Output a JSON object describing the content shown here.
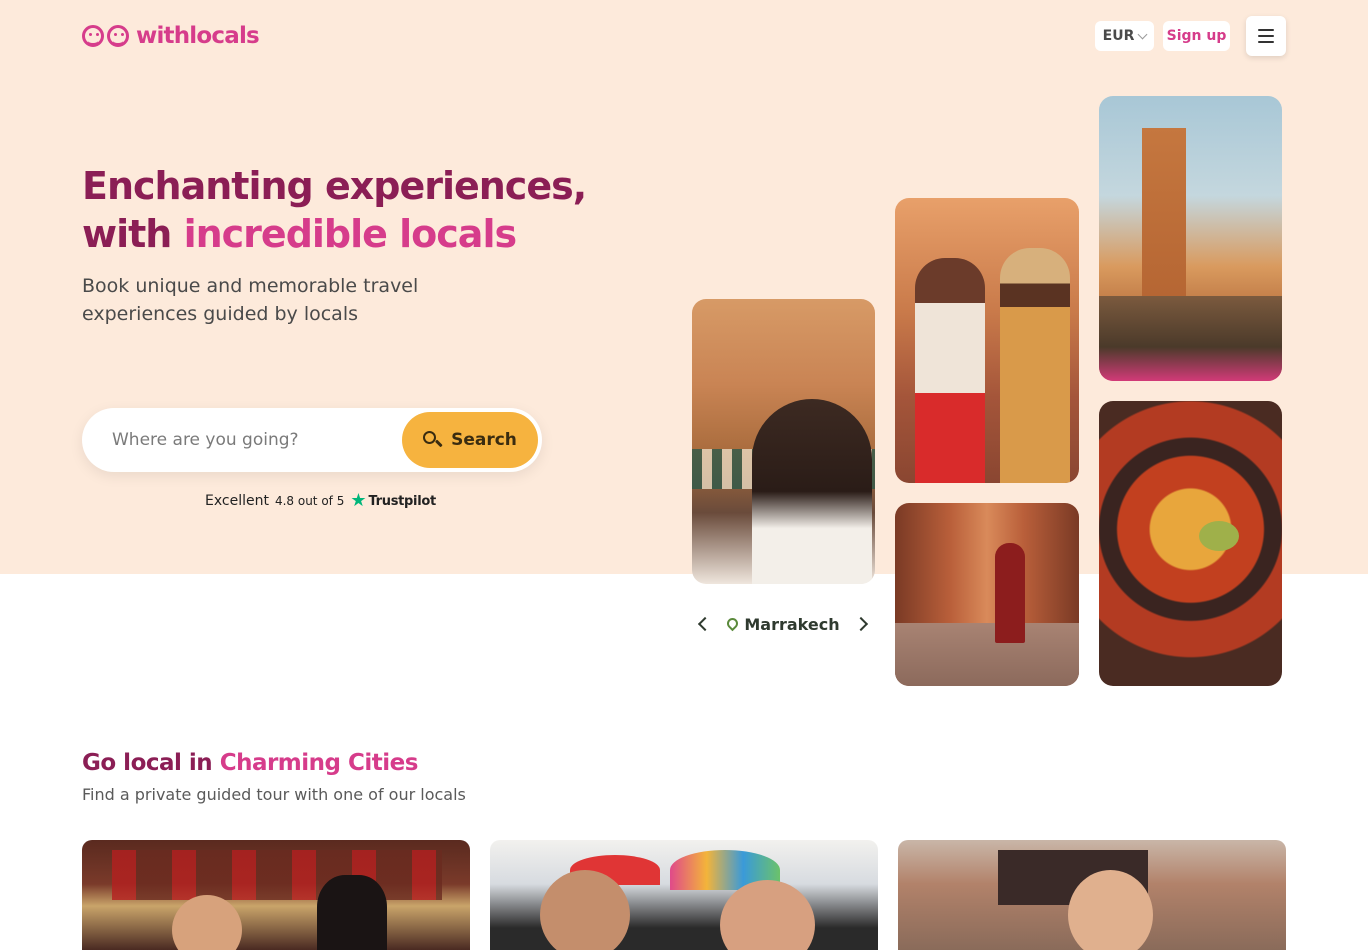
{
  "header": {
    "logo_text": "withlocals",
    "currency": "EUR",
    "signup_label": "Sign up"
  },
  "hero": {
    "headline_line1": "Enchanting experiences,",
    "headline_line2_prefix": "with ",
    "headline_line2_highlight": "incredible locals",
    "subline": "Book unique and memorable travel experiences guided by locals",
    "search": {
      "placeholder": "Where are you going?",
      "button_label": "Search"
    },
    "trustpilot": {
      "label": "Excellent",
      "rating": "4.8 out of 5",
      "brand": "Trustpilot"
    },
    "city": "Marrakech"
  },
  "section": {
    "title_prefix": "Go local in ",
    "title_highlight": "Charming Cities",
    "subtitle": "Find a private guided tour with one of our locals"
  },
  "colors": {
    "brand_pink": "#d63c8b",
    "brand_dark": "#8b1e55",
    "hero_bg": "#fdeadb",
    "search_button": "#f6b33f",
    "trustpilot_green": "#00b67a"
  },
  "icons": {
    "logo": "smiley-faces-icon",
    "currency_chevron": "chevron-down-icon",
    "menu": "hamburger-icon",
    "search": "search-icon",
    "trustpilot": "star-icon",
    "prev_city": "chevron-left-icon",
    "next_city": "chevron-right-icon",
    "location": "map-pin-icon"
  }
}
